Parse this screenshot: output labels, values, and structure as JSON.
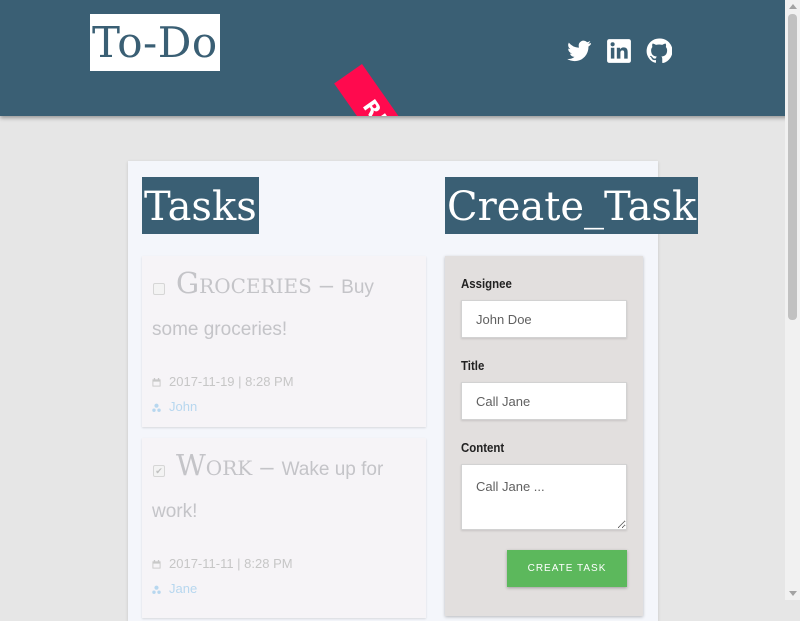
{
  "header": {
    "logo": "To-Do",
    "ribbon_text": "RIOT",
    "background": "#3a5f74",
    "social": [
      {
        "icon": "twitter-icon"
      },
      {
        "icon": "linkedin-icon"
      },
      {
        "icon": "github-icon"
      }
    ]
  },
  "tasks_section": {
    "title": "Tasks",
    "tasks": [
      {
        "title": "Groceries",
        "separator": "–",
        "desc_inline": "Buy",
        "desc_rest": "some groceries!",
        "timestamp": "2017-11-19 | 8:28 PM",
        "assignee": "John",
        "checked": false,
        "check_mark": ""
      },
      {
        "title": "Work",
        "separator": "–",
        "desc_inline": "Wake up for",
        "desc_rest": "work!",
        "timestamp": "2017-11-11 | 8:28 PM",
        "assignee": "Jane",
        "checked": true,
        "check_mark": "✔"
      }
    ]
  },
  "create_section": {
    "title": "Create_Task",
    "assignee_label": "Assignee",
    "assignee_placeholder": "John Doe",
    "title_label": "Title",
    "title_placeholder": "Call Jane",
    "content_label": "Content",
    "content_placeholder": "Call Jane ...",
    "button_label": "CREATE TASK",
    "button_color": "#5cb85c"
  }
}
